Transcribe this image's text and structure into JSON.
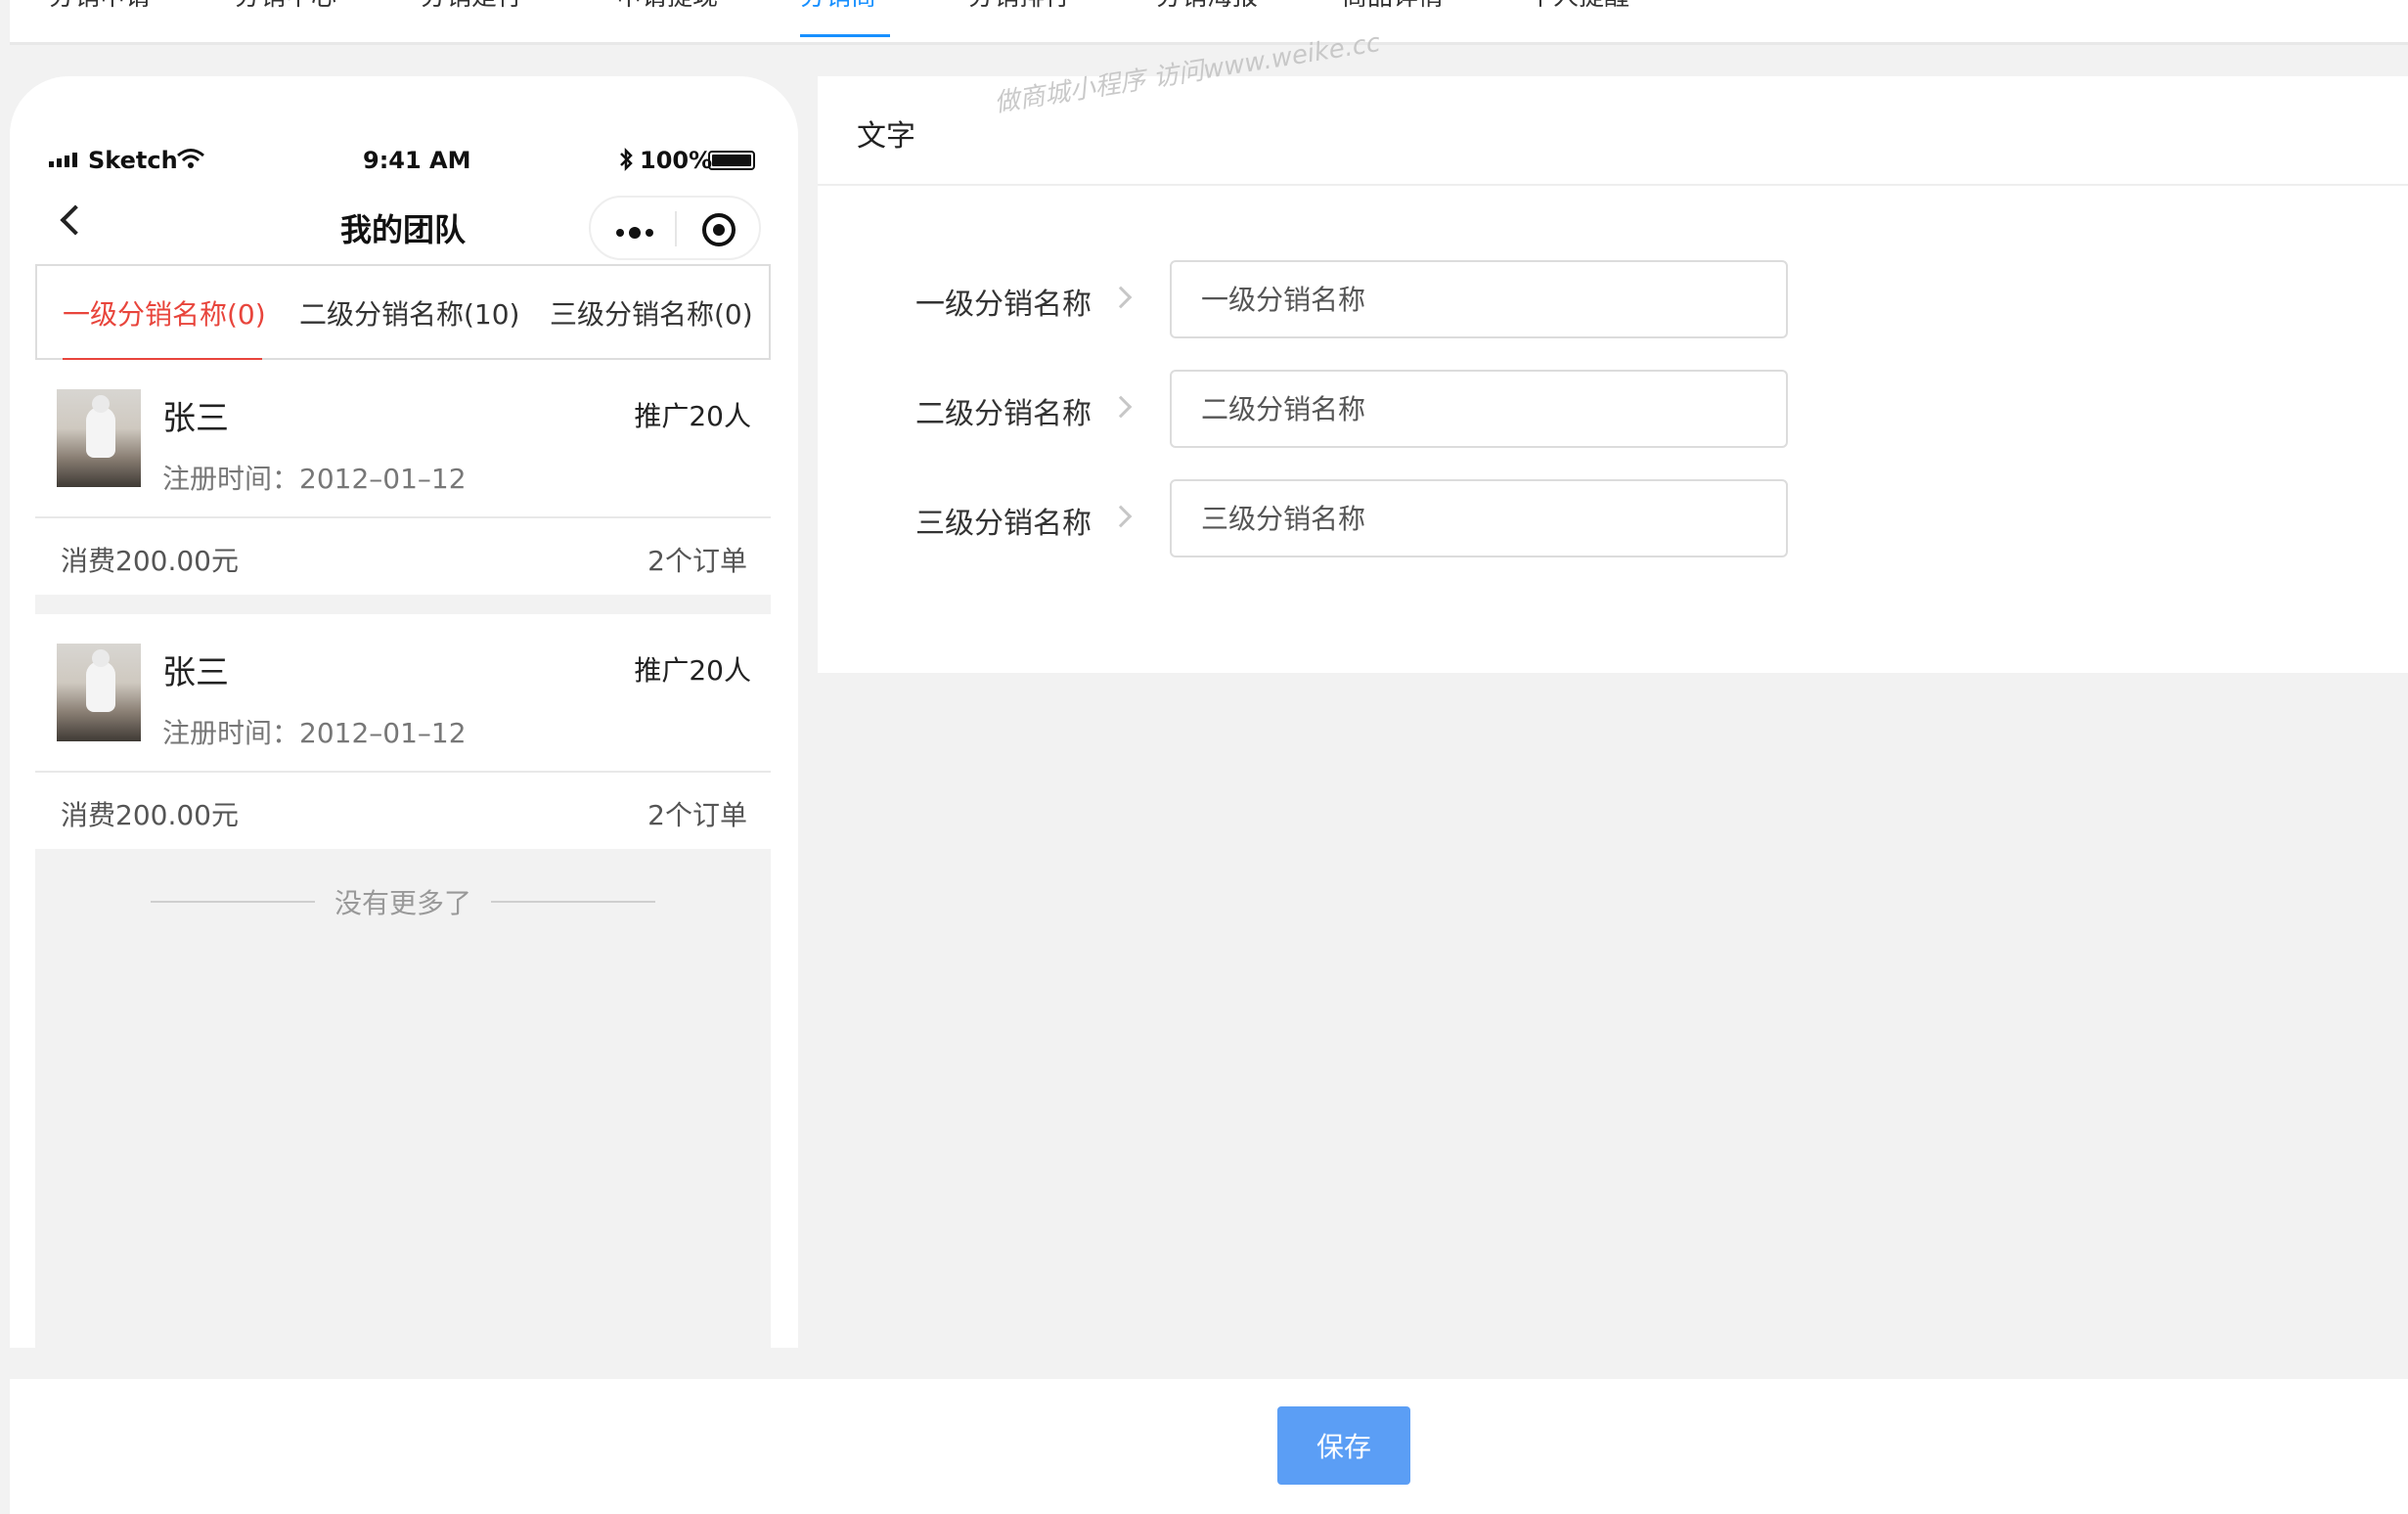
{
  "top_tabs": [
    {
      "label": "分销申请",
      "active": false
    },
    {
      "label": "分销中心",
      "active": false
    },
    {
      "label": "分销是行",
      "active": false
    },
    {
      "label": "申请提现",
      "active": false
    },
    {
      "label": "分销商",
      "active": true
    },
    {
      "label": "分销排行",
      "active": false
    },
    {
      "label": "分销海报",
      "active": false
    },
    {
      "label": "商品详情",
      "active": false
    },
    {
      "label": "个人提醒",
      "active": false
    }
  ],
  "watermark": "做商城小程序  访问www.weike.cc",
  "phone": {
    "status": {
      "carrier": "Sketch",
      "time": "9:41 AM",
      "battery": "100%"
    },
    "nav_title": "我的团队",
    "tabs": [
      "一级分销名称(0)",
      "二级分销名称(10)",
      "三级分销名称(0)"
    ],
    "members": [
      {
        "name": "张三",
        "promo": "推广20人",
        "registered": "注册时间：2012–01–12",
        "spend": "消费200.00元",
        "orders": "2个订单"
      },
      {
        "name": "张三",
        "promo": "推广20人",
        "registered": "注册时间：2012–01–12",
        "spend": "消费200.00元",
        "orders": "2个订单"
      }
    ],
    "no_more": "没有更多了"
  },
  "panel": {
    "title": "文字",
    "rows": [
      {
        "label": "一级分销名称",
        "placeholder": "一级分销名称"
      },
      {
        "label": "二级分销名称",
        "placeholder": "二级分销名称"
      },
      {
        "label": "三级分销名称",
        "placeholder": "三级分销名称"
      }
    ]
  },
  "footer": {
    "save_label": "保存"
  },
  "colors": {
    "accent": "#1890ff",
    "active_tab_red": "#e8453c",
    "save_button": "#5b9ef5"
  }
}
